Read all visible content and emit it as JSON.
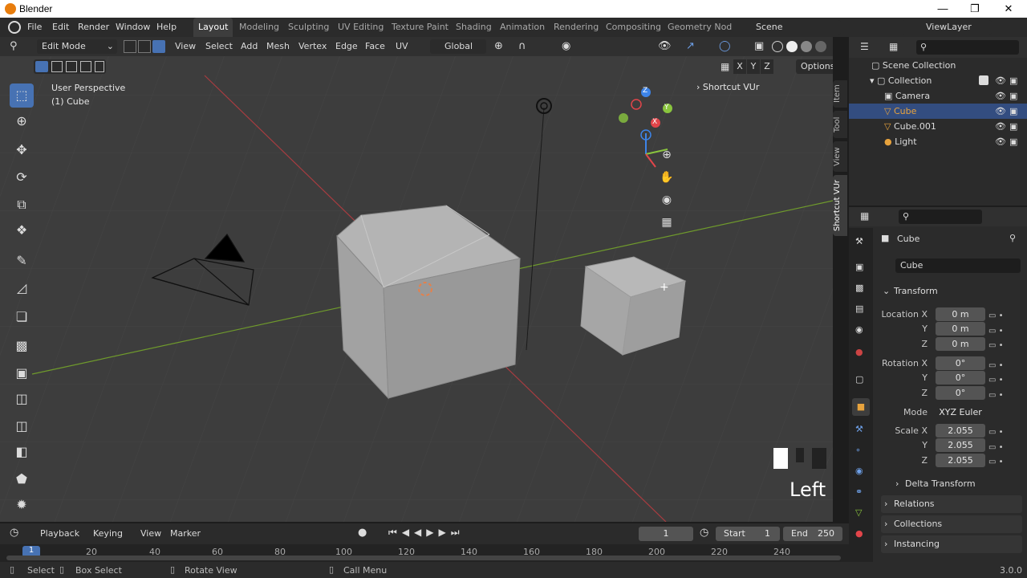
{
  "window": {
    "title": "Blender"
  },
  "menus": [
    "File",
    "Edit",
    "Render",
    "Window",
    "Help"
  ],
  "workspaces": [
    "Layout",
    "Modeling",
    "Sculpting",
    "UV Editing",
    "Texture Paint",
    "Shading",
    "Animation",
    "Rendering",
    "Compositing",
    "Geometry Nod"
  ],
  "active_workspace": "Layout",
  "scene": "Scene",
  "view_layer": "ViewLayer",
  "viewport_header": {
    "mode": "Edit Mode",
    "menus": [
      "View",
      "Select",
      "Add",
      "Mesh",
      "Vertex",
      "Edge",
      "Face",
      "UV"
    ],
    "orientation": "Global",
    "xyz": [
      "X",
      "Y",
      "Z"
    ],
    "options": "Options"
  },
  "viewport": {
    "view_name": "User Perspective",
    "object_name": "(1) Cube",
    "shortcut_panel": "Shortcut VUr",
    "overlay_text": "Left",
    "side_tabs": [
      "Item",
      "Tool",
      "View",
      "Shortcut VUr"
    ],
    "gizmo": {
      "x": "X",
      "y": "Y",
      "z": "Z"
    }
  },
  "outliner": {
    "root": "Scene Collection",
    "collection": "Collection",
    "items": [
      {
        "name": "Camera",
        "selected": false,
        "color": "#c8c8c8"
      },
      {
        "name": "Cube",
        "selected": true,
        "color": "#e8a33d"
      },
      {
        "name": "Cube.001",
        "selected": false,
        "color": "#c8c8c8"
      },
      {
        "name": "Light",
        "selected": false,
        "color": "#c8c8c8"
      }
    ]
  },
  "properties": {
    "object_name": "Cube",
    "data_name": "Cube",
    "transform_label": "Transform",
    "location": {
      "label": "Location X",
      "x": "0 m",
      "y": "0 m",
      "z": "0 m"
    },
    "rotation": {
      "label": "Rotation X",
      "x": "0°",
      "y": "0°",
      "z": "0°"
    },
    "mode_label": "Mode",
    "mode_value": "XYZ Euler",
    "scale": {
      "label": "Scale X",
      "x": "2.055",
      "y": "2.055",
      "z": "2.055"
    },
    "axis_y": "Y",
    "axis_z": "Z",
    "sections": [
      "Delta Transform",
      "Relations",
      "Collections",
      "Instancing"
    ]
  },
  "timeline": {
    "menus": [
      "Playback",
      "Keying",
      "View",
      "Marker"
    ],
    "current_frame": "1",
    "start_label": "Start",
    "start": "1",
    "end_label": "End",
    "end": "250",
    "ticks": [
      "1",
      "20",
      "40",
      "60",
      "80",
      "100",
      "120",
      "140",
      "160",
      "180",
      "200",
      "220",
      "240"
    ]
  },
  "status_bar": {
    "select": "Select",
    "box_select": "Box Select",
    "rotate_view": "Rotate View",
    "call_menu": "Call Menu",
    "version": "3.0.0"
  },
  "colors": {
    "accent": "#4772b3",
    "selection": "#334d80",
    "x_axis": "#e2454a",
    "y_axis": "#8ac53e",
    "z_axis": "#3d84e8"
  }
}
